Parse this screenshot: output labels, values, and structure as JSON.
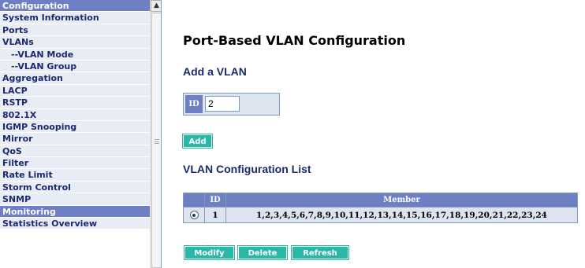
{
  "nav": {
    "items": [
      {
        "label": "Configuration",
        "type": "header"
      },
      {
        "label": "System Information",
        "type": "link"
      },
      {
        "label": "Ports",
        "type": "link"
      },
      {
        "label": "VLANs",
        "type": "link"
      },
      {
        "label": "--VLAN Mode",
        "type": "sub"
      },
      {
        "label": "--VLAN Group",
        "type": "sub"
      },
      {
        "label": "Aggregation",
        "type": "link"
      },
      {
        "label": "LACP",
        "type": "link"
      },
      {
        "label": "RSTP",
        "type": "link"
      },
      {
        "label": "802.1X",
        "type": "link"
      },
      {
        "label": "IGMP Snooping",
        "type": "link"
      },
      {
        "label": "Mirror",
        "type": "link"
      },
      {
        "label": "QoS",
        "type": "link"
      },
      {
        "label": "Filter",
        "type": "link"
      },
      {
        "label": "Rate Limit",
        "type": "link"
      },
      {
        "label": "Storm Control",
        "type": "link"
      },
      {
        "label": "SNMP",
        "type": "link"
      },
      {
        "label": "Monitoring",
        "type": "header"
      },
      {
        "label": "Statistics Overview",
        "type": "link"
      }
    ]
  },
  "page": {
    "title": "Port-Based VLAN Configuration",
    "add_section_title": "Add a VLAN",
    "list_section_title": "VLAN Configuration List"
  },
  "add_form": {
    "id_label": "ID",
    "id_value": "2",
    "add_button": "Add"
  },
  "vlan_table": {
    "headers": [
      "",
      "ID",
      "Member"
    ],
    "rows": [
      {
        "selected": true,
        "id": "1",
        "member": "1,2,3,4,5,6,7,8,9,10,11,12,13,14,15,16,17,18,19,20,21,22,23,24"
      }
    ]
  },
  "actions": {
    "modify": "Modify",
    "delete": "Delete",
    "refresh": "Refresh"
  },
  "icons": {
    "scroll_up": "chevron-up-icon",
    "radio": "radio-selected-icon"
  },
  "colors": {
    "nav_header": "#6f7fc4",
    "nav_item_bg": "#e8edf5",
    "nav_text": "#1a2a6c",
    "button": "#2ab8a6",
    "table_header": "#6f7fc4",
    "table_cell": "#dde4f0"
  }
}
